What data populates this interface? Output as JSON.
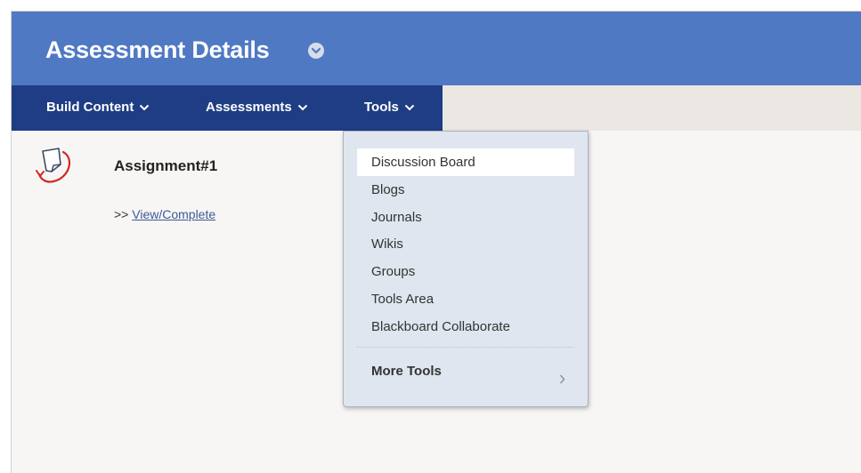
{
  "header": {
    "title": "Assessment Details"
  },
  "nav": {
    "items": [
      {
        "label": "Build Content"
      },
      {
        "label": "Assessments"
      },
      {
        "label": "Tools"
      }
    ],
    "active": "Tools"
  },
  "content": {
    "item_title": "Assignment#1",
    "link_prefix": ">>",
    "link_text": "View/Complete"
  },
  "tools_menu": {
    "items": [
      {
        "label": "Discussion Board"
      },
      {
        "label": "Blogs"
      },
      {
        "label": "Journals"
      },
      {
        "label": "Wikis"
      },
      {
        "label": "Groups"
      },
      {
        "label": "Tools Area"
      },
      {
        "label": "Blackboard Collaborate"
      }
    ],
    "highlighted": "Discussion Board",
    "more_label": "More Tools"
  },
  "colors": {
    "title_bar": "#4f79c3",
    "nav_bar": "#1f3d84",
    "menu_background": "#dfe6ef",
    "page_background": "#f8f6f4",
    "link": "#3b5a9a"
  },
  "icons": {
    "title_menu": "chevron-down-circle-icon",
    "nav_dropdown": "chevron-down-icon",
    "content_item": "assignment-icon",
    "submenu": "chevron-right-icon"
  }
}
